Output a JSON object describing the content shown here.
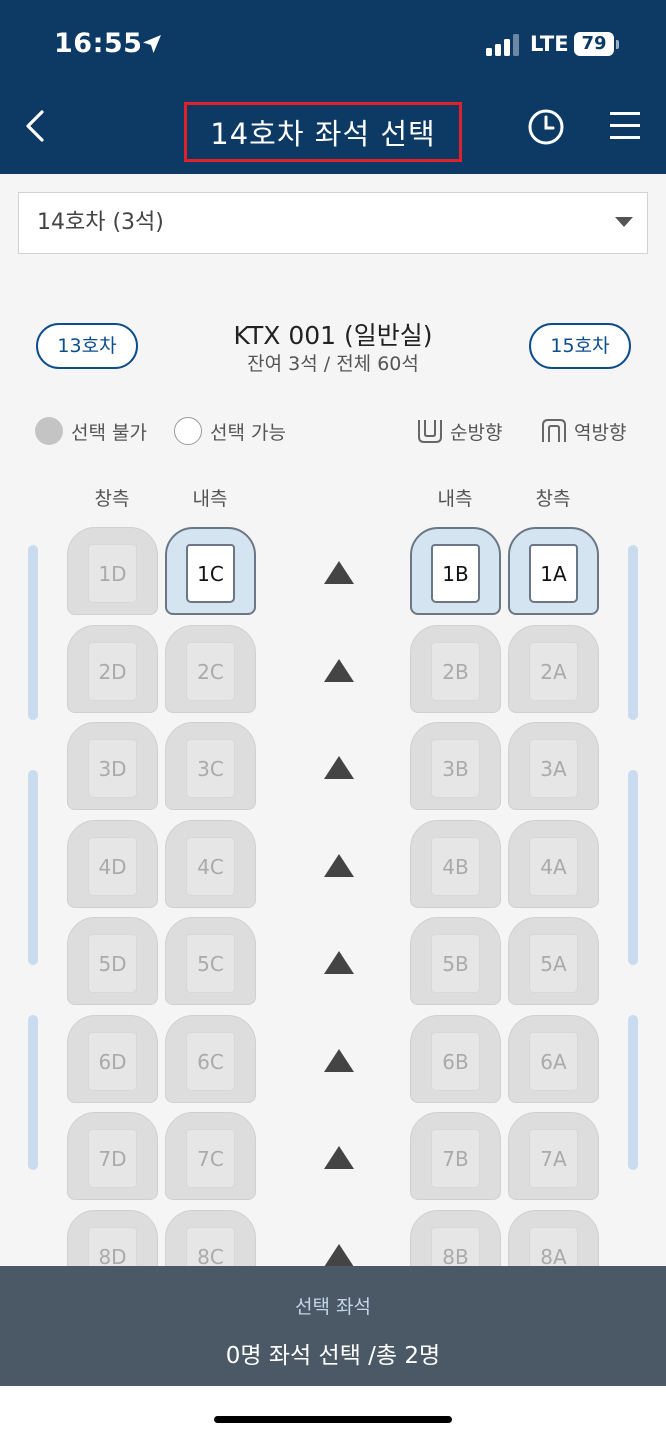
{
  "status_bar": {
    "time": "16:55",
    "network": "LTE",
    "battery": "79"
  },
  "header": {
    "title": "14호차 좌석 선택",
    "icons": [
      "back-icon",
      "clock-icon",
      "menu-icon"
    ]
  },
  "car_selector": {
    "value": "14호차 (3석)"
  },
  "train_info": {
    "prev_car": "13호차",
    "next_car": "15호차",
    "name": "KTX 001 (일반실)",
    "seats_summary": "잔여 3석 / 전체 60석"
  },
  "legend": {
    "unavailable": "선택 불가",
    "available": "선택 가능",
    "forward": "순방향",
    "reverse": "역방향"
  },
  "columns": {
    "left_window": "창측",
    "left_aisle": "내측",
    "right_aisle": "내측",
    "right_window": "창측"
  },
  "seats": [
    [
      "1D",
      "1C",
      "1B",
      "1A"
    ],
    [
      "2D",
      "2C",
      "2B",
      "2A"
    ],
    [
      "3D",
      "3C",
      "3B",
      "3A"
    ],
    [
      "4D",
      "4C",
      "4B",
      "4A"
    ],
    [
      "5D",
      "5C",
      "5B",
      "5A"
    ],
    [
      "6D",
      "6C",
      "6B",
      "6A"
    ],
    [
      "7D",
      "7C",
      "7B",
      "7A"
    ],
    [
      "8D",
      "8C",
      "8B",
      "8A"
    ]
  ],
  "available_seats": [
    "1C",
    "1B",
    "1A"
  ],
  "colors": {
    "header_bg": "#0c3a64",
    "highlight_border": "#e0212a",
    "accent": "#0c4d8c",
    "bottom_panel": "#4b5866"
  },
  "bottom_panel": {
    "label": "선택 좌석",
    "summary": "0명 좌석 선택 /총 2명"
  }
}
